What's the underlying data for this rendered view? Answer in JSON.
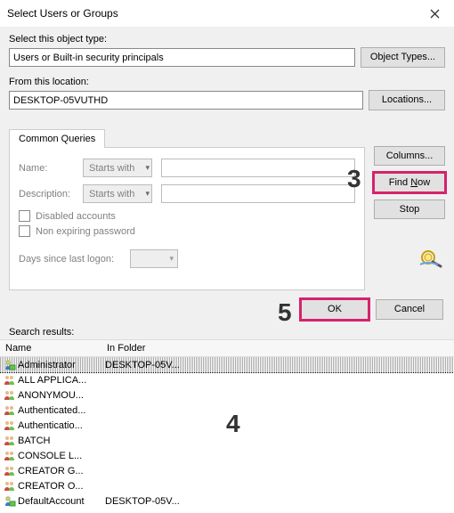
{
  "title": "Select Users or Groups",
  "object_type": {
    "label": "Select this object type:",
    "value": "Users or Built-in security principals",
    "button": "Object Types..."
  },
  "location": {
    "label": "From this location:",
    "value": "DESKTOP-05VUTHD",
    "button": "Locations..."
  },
  "tab": "Common Queries",
  "queries": {
    "name_label": "Name:",
    "name_combo": "Starts with",
    "desc_label": "Description:",
    "desc_combo": "Starts with",
    "disabled": "Disabled accounts",
    "nonexpiring": "Non expiring password",
    "logon_label": "Days since last logon:"
  },
  "side": {
    "columns": "Columns...",
    "find": "Find Now",
    "stop": "Stop"
  },
  "actions": {
    "ok": "OK",
    "cancel": "Cancel"
  },
  "results": {
    "label": "Search results:",
    "col_name": "Name",
    "col_folder": "In Folder",
    "rows": [
      {
        "name": "Administrator",
        "folder": "DESKTOP-05V...",
        "type": "user",
        "selected": true
      },
      {
        "name": "ALL APPLICA...",
        "folder": "",
        "type": "group"
      },
      {
        "name": "ANONYMOU...",
        "folder": "",
        "type": "group"
      },
      {
        "name": "Authenticated...",
        "folder": "",
        "type": "group"
      },
      {
        "name": "Authenticatio...",
        "folder": "",
        "type": "group"
      },
      {
        "name": "BATCH",
        "folder": "",
        "type": "group"
      },
      {
        "name": "CONSOLE L...",
        "folder": "",
        "type": "group"
      },
      {
        "name": "CREATOR G...",
        "folder": "",
        "type": "group"
      },
      {
        "name": "CREATOR O...",
        "folder": "",
        "type": "group"
      },
      {
        "name": "DefaultAccount",
        "folder": "DESKTOP-05V...",
        "type": "user"
      }
    ]
  },
  "annotations": {
    "a3": "3",
    "a4": "4",
    "a5": "5"
  }
}
